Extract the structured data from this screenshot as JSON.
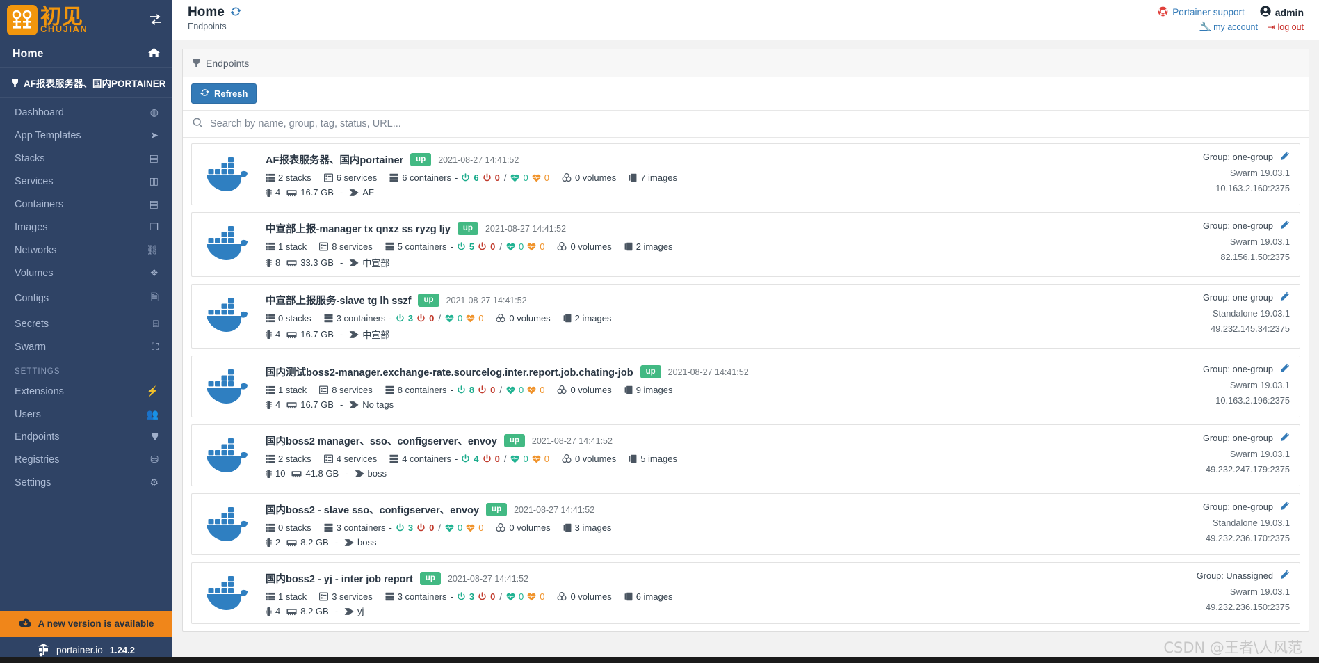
{
  "sidebar": {
    "logo": {
      "cn_big": "初见",
      "cn_sub": "CHUJIAN",
      "toggle_icon": "toggle-sidebar-icon"
    },
    "home_label": "Home",
    "home_icon": "home-icon",
    "active_endpoint": "AF报表服务器、国内PORTAINER",
    "active_endpoint_icon": "plug-icon",
    "items": [
      {
        "label": "Dashboard",
        "icon": "tachometer-icon"
      },
      {
        "label": "App Templates",
        "icon": "rocket-icon"
      },
      {
        "label": "Stacks",
        "icon": "th-list-icon"
      },
      {
        "label": "Services",
        "icon": "list-alt-icon"
      },
      {
        "label": "Containers",
        "icon": "server-icon"
      },
      {
        "label": "Images",
        "icon": "clone-icon"
      },
      {
        "label": "Networks",
        "icon": "sitemap-icon"
      },
      {
        "label": "Volumes",
        "icon": "cubes-icon"
      },
      {
        "label": "Configs",
        "icon": "file-code-icon"
      },
      {
        "label": "Secrets",
        "icon": "key-icon"
      },
      {
        "label": "Swarm",
        "icon": "object-group-icon"
      }
    ],
    "settings_section": "Settings",
    "settings_items": [
      {
        "label": "Extensions",
        "icon": "bolt-icon"
      },
      {
        "label": "Users",
        "icon": "users-icon"
      },
      {
        "label": "Endpoints",
        "icon": "plug-icon"
      },
      {
        "label": "Registries",
        "icon": "database-icon"
      },
      {
        "label": "Settings",
        "icon": "cog-icon"
      }
    ],
    "update_banner": "A new version is available",
    "update_icon": "cloud-download-icon",
    "footer_brand": "portainer.io",
    "footer_icon": "portainer-logo-icon",
    "footer_version": "1.24.2"
  },
  "topbar": {
    "title": "Home",
    "refresh_icon": "refresh-icon",
    "subtitle": "Endpoints",
    "support_label": "Portainer support",
    "support_icon": "life-ring-icon",
    "user_label": "admin",
    "user_icon": "user-circle-icon",
    "my_account_label": "my account",
    "my_account_icon": "wrench-icon",
    "logout_label": "log out",
    "logout_icon": "sign-out-icon"
  },
  "panel": {
    "header_title": "Endpoints",
    "header_icon": "plug-icon",
    "refresh_button": "Refresh",
    "refresh_button_icon": "sync-icon",
    "search_placeholder": "Search by name, group, tag, status, URL...",
    "search_value": "",
    "search_icon": "search-icon"
  },
  "labels": {
    "stacks_singular": "stack",
    "stacks_plural": "stacks",
    "services": "services",
    "containers": "containers",
    "volumes": "volumes",
    "images": "images",
    "group_prefix": "Group:",
    "dash": "-",
    "slash": "/"
  },
  "endpoints": [
    {
      "name": "AF报表服务器、国内portainer",
      "status": "up",
      "date": "2021-08-27 14:41:52",
      "stacks": "2 stacks",
      "services": "6 services",
      "containers": "6 containers",
      "running": "6",
      "stopped": "0",
      "healthy": "0",
      "unhealthy": "0",
      "volumes": "0 volumes",
      "images": "7 images",
      "cpu": "4",
      "memory": "16.7 GB",
      "tags": "AF",
      "group": "Group: one-group",
      "mode": "Swarm 19.03.1",
      "url": "10.163.2.160:2375"
    },
    {
      "name": "中宣部上报-manager tx qnxz ss ryzg ljy",
      "status": "up",
      "date": "2021-08-27 14:41:52",
      "stacks": "1 stack",
      "services": "8 services",
      "containers": "5 containers",
      "running": "5",
      "stopped": "0",
      "healthy": "0",
      "unhealthy": "0",
      "volumes": "0 volumes",
      "images": "2 images",
      "cpu": "8",
      "memory": "33.3 GB",
      "tags": "中宣部",
      "group": "Group: one-group",
      "mode": "Swarm 19.03.1",
      "url": "82.156.1.50:2375"
    },
    {
      "name": "中宣部上报服务-slave tg lh sszf",
      "status": "up",
      "date": "2021-08-27 14:41:52",
      "stacks": "0 stacks",
      "services": null,
      "containers": "3 containers",
      "running": "3",
      "stopped": "0",
      "healthy": "0",
      "unhealthy": "0",
      "volumes": "0 volumes",
      "images": "2 images",
      "cpu": "4",
      "memory": "16.7 GB",
      "tags": "中宣部",
      "group": "Group: one-group",
      "mode": "Standalone 19.03.1",
      "url": "49.232.145.34:2375"
    },
    {
      "name": "国内测试boss2-manager.exchange-rate.sourcelog.inter.report.job.chating-job",
      "status": "up",
      "date": "2021-08-27 14:41:52",
      "stacks": "1 stack",
      "services": "8 services",
      "containers": "8 containers",
      "running": "8",
      "stopped": "0",
      "healthy": "0",
      "unhealthy": "0",
      "volumes": "0 volumes",
      "images": "9 images",
      "cpu": "4",
      "memory": "16.7 GB",
      "tags": "No tags",
      "group": "Group: one-group",
      "mode": "Swarm 19.03.1",
      "url": "10.163.2.196:2375"
    },
    {
      "name": "国内boss2 manager、sso、configserver、envoy",
      "status": "up",
      "date": "2021-08-27 14:41:52",
      "stacks": "2 stacks",
      "services": "4 services",
      "containers": "4 containers",
      "running": "4",
      "stopped": "0",
      "healthy": "0",
      "unhealthy": "0",
      "volumes": "0 volumes",
      "images": "5 images",
      "cpu": "10",
      "memory": "41.8 GB",
      "tags": "boss",
      "group": "Group: one-group",
      "mode": "Swarm 19.03.1",
      "url": "49.232.247.179:2375"
    },
    {
      "name": "国内boss2 - slave sso、configserver、envoy",
      "status": "up",
      "date": "2021-08-27 14:41:52",
      "stacks": "0 stacks",
      "services": null,
      "containers": "3 containers",
      "running": "3",
      "stopped": "0",
      "healthy": "0",
      "unhealthy": "0",
      "volumes": "0 volumes",
      "images": "3 images",
      "cpu": "2",
      "memory": "8.2 GB",
      "tags": "boss",
      "group": "Group: one-group",
      "mode": "Standalone 19.03.1",
      "url": "49.232.236.170:2375"
    },
    {
      "name": "国内boss2 - yj - inter job report",
      "status": "up",
      "date": "2021-08-27 14:41:52",
      "stacks": "1 stack",
      "services": "3 services",
      "containers": "3 containers",
      "running": "3",
      "stopped": "0",
      "healthy": "0",
      "unhealthy": "0",
      "volumes": "0 volumes",
      "images": "6 images",
      "cpu": "4",
      "memory": "8.2 GB",
      "tags": "yj",
      "group": "Group: Unassigned",
      "mode": "Swarm 19.03.1",
      "url": "49.232.236.150:2375"
    }
  ],
  "watermark": "CSDN @王者\\人风范",
  "colors": {
    "sidebar_bg": "#2f4365",
    "accent_blue": "#337ab7",
    "status_green": "#42b983",
    "orange": "#f0861a",
    "running_green": "#1aab8b",
    "stopped_red": "#c0392b"
  }
}
